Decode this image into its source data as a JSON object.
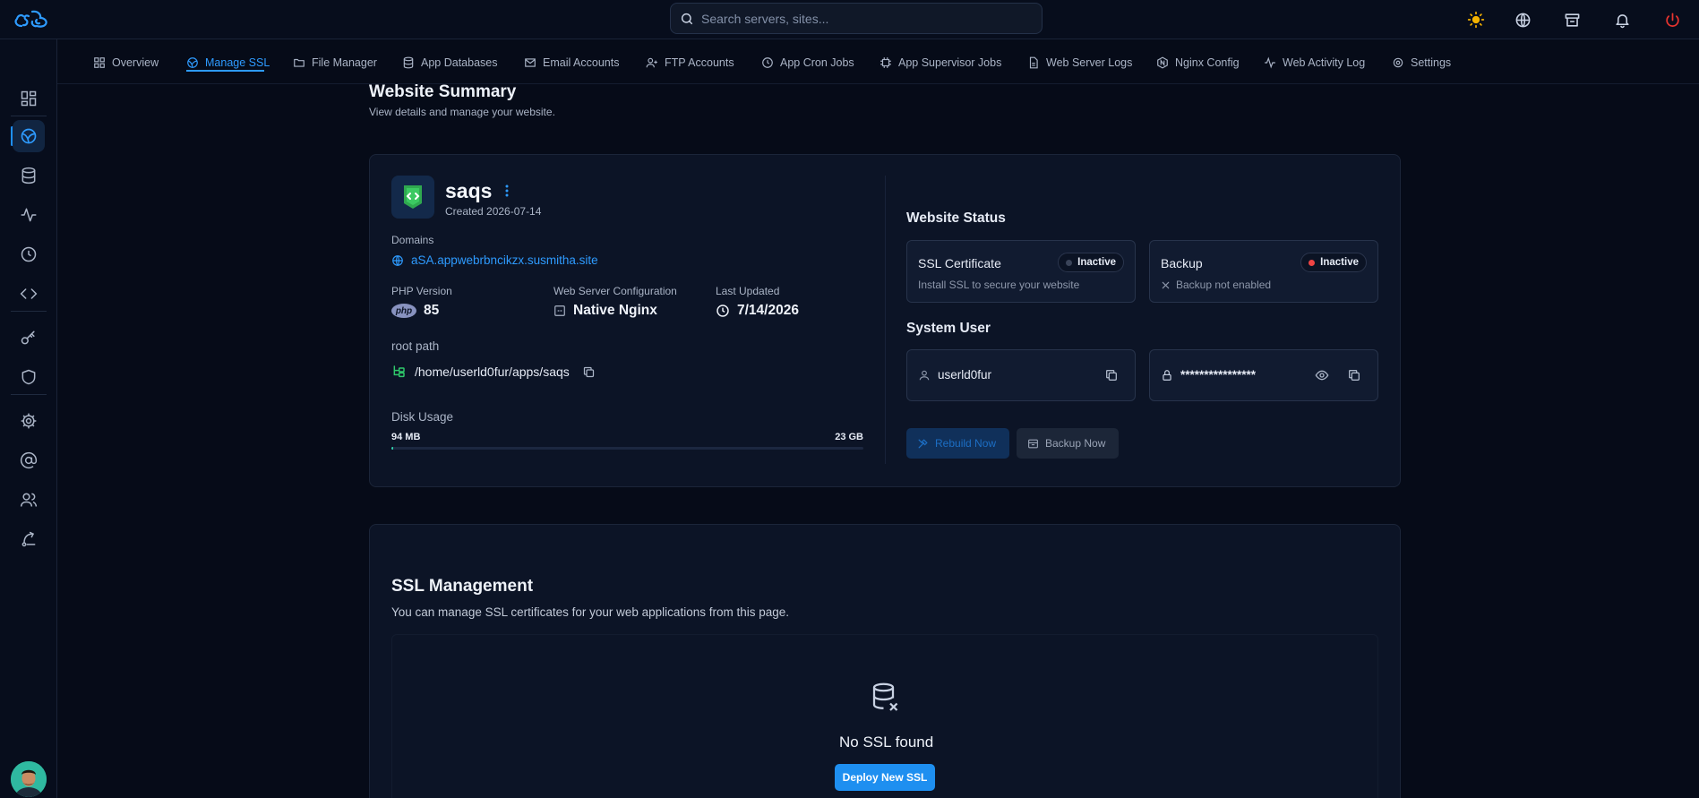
{
  "search": {
    "placeholder": "Search servers, sites..."
  },
  "topbar": {
    "icons": [
      "sun-icon",
      "globe-icon",
      "store-icon",
      "bell-icon",
      "power-icon"
    ],
    "accent": "#2e9bff",
    "power_color": "#e8342f",
    "sun_color": "#f5b300"
  },
  "rail": {
    "items": [
      "dashboard-icon",
      "globe-icon",
      "database-icon",
      "activity-icon",
      "clock-icon",
      "code-icon",
      "key-icon",
      "shield-icon",
      "gear-icon",
      "at-icon",
      "users-icon",
      "route-icon"
    ],
    "active_index": 1
  },
  "tabs": [
    {
      "label": "Overview",
      "icon": "grid-icon"
    },
    {
      "label": "Manage SSL",
      "icon": "globe-lock-icon",
      "active": true
    },
    {
      "label": "File Manager",
      "icon": "folder-icon"
    },
    {
      "label": "App Databases",
      "icon": "database-icon"
    },
    {
      "label": "Email Accounts",
      "icon": "mail-icon"
    },
    {
      "label": "FTP Accounts",
      "icon": "user-plus-icon"
    },
    {
      "label": "App Cron Jobs",
      "icon": "clock-icon"
    },
    {
      "label": "App Supervisor Jobs",
      "icon": "cpu-icon"
    },
    {
      "label": "Web Server Logs",
      "icon": "file-icon"
    },
    {
      "label": "Nginx Config",
      "icon": "hexagon-icon"
    },
    {
      "label": "Web Activity Log",
      "icon": "activity-icon"
    },
    {
      "label": "Settings",
      "icon": "gear-icon"
    }
  ],
  "summary": {
    "title": "Website Summary",
    "subtitle": "View details and manage your website."
  },
  "site": {
    "name": "saqs",
    "created": "Created 2026-07-14",
    "domains_label": "Domains",
    "domain": "aSA.appwebrbncikzx.susmitha.site",
    "php_label": "PHP Version",
    "php_value": "85",
    "php_badge": "php",
    "webserver_label": "Web Server Configuration",
    "webserver_value": "Native Nginx",
    "updated_label": "Last Updated",
    "updated_value": "7/14/2026",
    "root_label": "root path",
    "root_value": "/home/userld0fur/apps/saqs",
    "disk_label": "Disk Usage",
    "disk_used": "94 MB",
    "disk_total": "23 GB",
    "disk_fraction": 0.004
  },
  "status": {
    "title": "Website Status",
    "ssl": {
      "title": "SSL Certificate",
      "badge": "Inactive",
      "sub": "Install SSL to secure your website",
      "dot_color": "#3a4459"
    },
    "backup": {
      "title": "Backup",
      "badge": "Inactive",
      "sub": "Backup not enabled",
      "dot_color": "#ef4444"
    }
  },
  "system_user": {
    "title": "System User",
    "username": "userld0fur",
    "password_mask": "****************"
  },
  "actions": {
    "rebuild": "Rebuild Now",
    "backup": "Backup Now"
  },
  "ssl_management": {
    "title": "SSL Management",
    "subtitle": "You can manage SSL certificates for your web applications from this page.",
    "empty_title": "No SSL found",
    "deploy_button": "Deploy New SSL"
  }
}
